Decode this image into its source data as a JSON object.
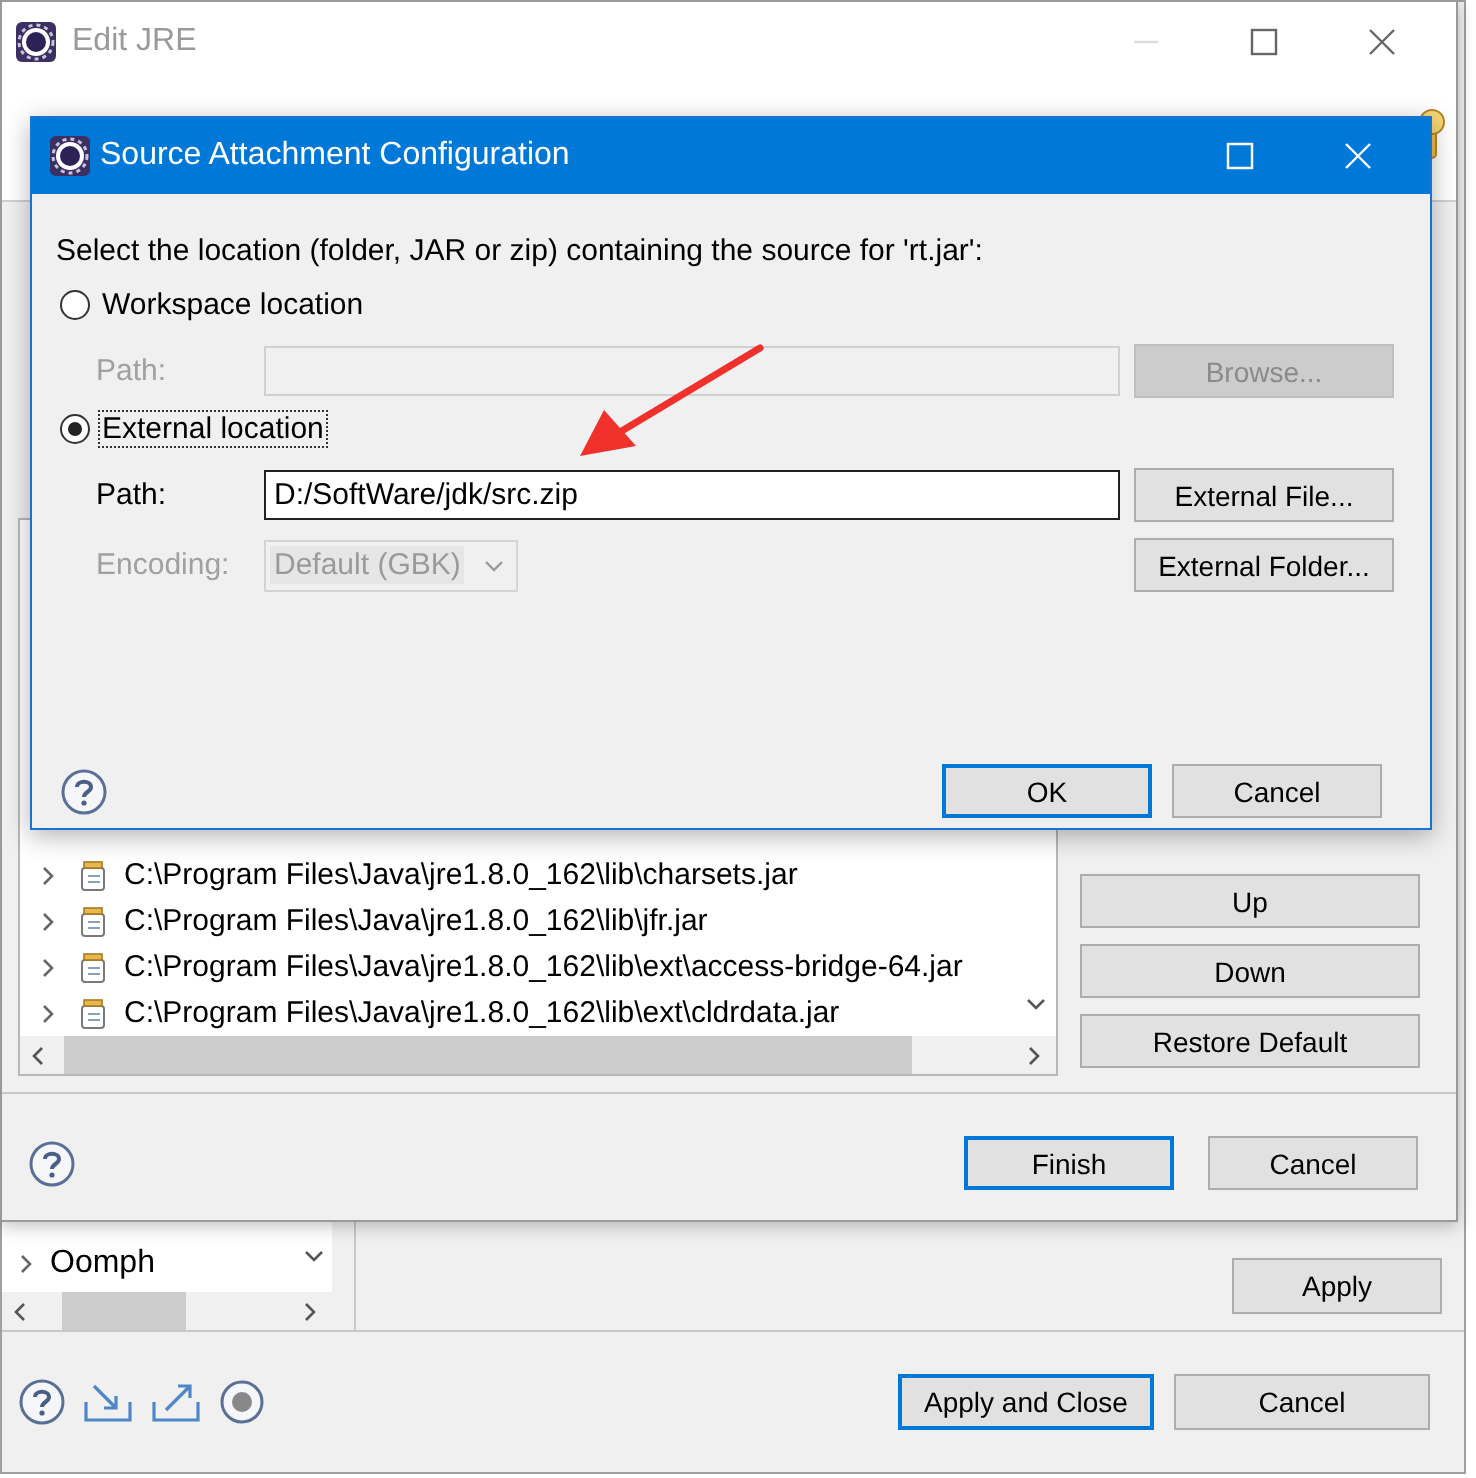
{
  "preferences": {
    "tree_items": [
      {
        "label": "Oomph",
        "expanded": false
      }
    ],
    "apply_button": {
      "label": "Apply"
    },
    "buttons": [
      {
        "label": "Apply and Close",
        "default": true
      },
      {
        "label": "Cancel",
        "default": false
      }
    ]
  },
  "edit_jre": {
    "title": "Edit JRE",
    "libraries": [
      {
        "path": "C:\\Program Files\\Java\\jre1.8.0_162\\lib\\charsets.jar",
        "expanded": false
      },
      {
        "path": "C:\\Program Files\\Java\\jre1.8.0_162\\lib\\jfr.jar",
        "expanded": false
      },
      {
        "path": "C:\\Program Files\\Java\\jre1.8.0_162\\lib\\ext\\access-bridge-64.jar",
        "expanded": false
      },
      {
        "path": "C:\\Program Files\\Java\\jre1.8.0_162\\lib\\ext\\cldrdata.jar",
        "expanded": false
      }
    ],
    "side_buttons": [
      {
        "label": "Up"
      },
      {
        "label": "Down"
      },
      {
        "label": "Restore Default"
      }
    ],
    "buttons": [
      {
        "label": "Finish",
        "default": true
      },
      {
        "label": "Cancel",
        "default": false
      }
    ]
  },
  "source_dialog": {
    "title": "Source Attachment Configuration",
    "instruction": "Select the location (folder, JAR or zip) containing the source for 'rt.jar':",
    "options": [
      {
        "label": "Workspace location",
        "selected": false
      },
      {
        "label": "External location",
        "selected": true
      }
    ],
    "workspace_path": {
      "label": "Path:",
      "disabled": true,
      "button": "Browse..."
    },
    "external_path": {
      "label": "Path:",
      "value": "D:/SoftWare/jdk/src.zip",
      "disabled": false,
      "button": "External File..."
    },
    "encoding": {
      "label": "Encoding:",
      "value": "Default (GBK)",
      "disabled": true,
      "button": "External Folder..."
    },
    "buttons": [
      {
        "label": "OK",
        "default": true
      },
      {
        "label": "Cancel",
        "default": false
      }
    ]
  }
}
